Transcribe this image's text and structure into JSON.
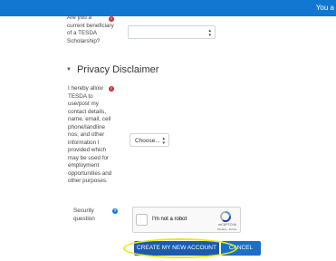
{
  "topbar": {
    "user_text": "You a"
  },
  "tesda_question": {
    "label_lines": [
      "Are you a",
      "current beneficiary",
      "of a TESDA",
      "Scholarship?"
    ],
    "required_mark": "!",
    "select_value": ""
  },
  "privacy_section": {
    "title": "Privacy Disclaimer"
  },
  "privacy_question": {
    "label_lines": [
      "I hereby allow",
      "TESDA to",
      "use/post my",
      "contact details,",
      "name, email, cell",
      "phone/landline",
      "nos, and other",
      "information I",
      "provided which",
      "may be used for",
      "employment",
      "opportunities and",
      "other purposes."
    ],
    "required_mark": "!",
    "select_value": "Choose..."
  },
  "security_question": {
    "label_lines": [
      "Security",
      "question"
    ],
    "help_mark": "?"
  },
  "recaptcha": {
    "label": "I'm not a robot",
    "brand": "reCAPTCHA",
    "terms": "Privacy - Terms"
  },
  "actions": {
    "submit_label": "CREATE MY NEW ACCOUNT",
    "cancel_label": "CANCEL"
  },
  "colors": {
    "topbar": "#1177d1",
    "primary_button": "#1a5bb0",
    "required": "#c9302c",
    "highlight": "#e6ea14"
  }
}
